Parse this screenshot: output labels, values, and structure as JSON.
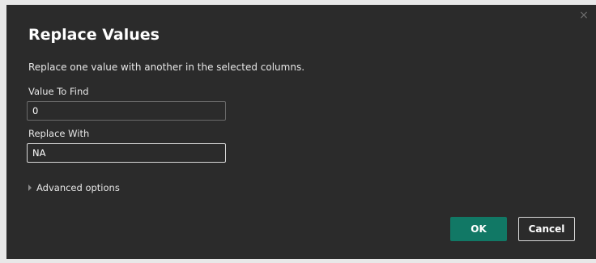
{
  "dialog": {
    "title": "Replace Values",
    "description": "Replace one value with another in the selected columns.",
    "close_icon": "×"
  },
  "fields": {
    "find": {
      "label": "Value To Find",
      "value": "0"
    },
    "replace": {
      "label": "Replace With",
      "value": "NA"
    }
  },
  "advanced": {
    "label": "Advanced options"
  },
  "buttons": {
    "ok": "OK",
    "cancel": "Cancel"
  },
  "colors": {
    "background": "#2b2b2b",
    "accent": "#117865",
    "text": "#ffffff"
  }
}
